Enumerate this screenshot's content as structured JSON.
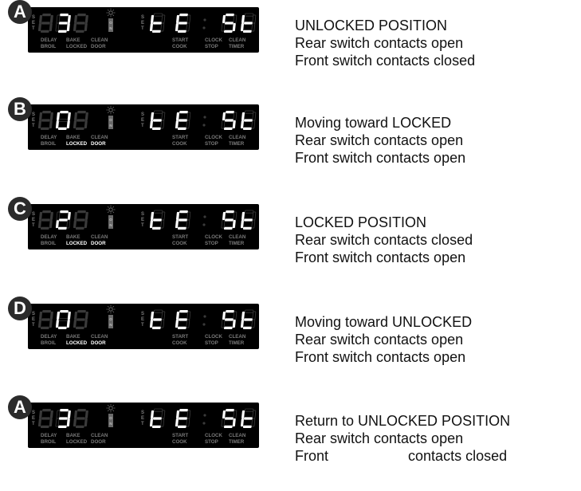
{
  "panel_labels": {
    "set": [
      "S",
      "E",
      "T"
    ],
    "left_row1": [
      "DELAY",
      "BAKE",
      "CLEAN"
    ],
    "left_row2": [
      "BROIL",
      "LOCKED",
      "DOOR"
    ],
    "right_row1": [
      "START",
      "CLOCK",
      "CLEAN"
    ],
    "right_row2": [
      "COOK",
      "STOP",
      "TIMER"
    ],
    "on_indicator": "O N"
  },
  "colors": {
    "panel": "#000000",
    "segment_on": "#ffffff",
    "segment_off": "#3a3a3a",
    "label_dim": "#7a7a7a",
    "label_bright": "#ffffff",
    "badge": "#2b2b2b"
  },
  "rows": [
    {
      "badge": "A",
      "left_digits": [
        "8",
        "3",
        "8"
      ],
      "left_lit": [
        false,
        true,
        false
      ],
      "right_text": [
        "t",
        "E",
        ":",
        "S",
        "t"
      ],
      "highlight_locked_door": false,
      "status": [
        "UNLOCKED POSITION",
        "Rear switch contacts open",
        "Front switch contacts closed"
      ]
    },
    {
      "badge": "B",
      "left_digits": [
        "8",
        "0",
        "8"
      ],
      "left_lit": [
        false,
        true,
        false
      ],
      "right_text": [
        "t",
        "E",
        ":",
        "S",
        "t"
      ],
      "highlight_locked_door": true,
      "status": [
        "Moving toward LOCKED",
        "Rear switch contacts open",
        "Front switch contacts open"
      ]
    },
    {
      "badge": "C",
      "left_digits": [
        "8",
        "2",
        "8"
      ],
      "left_lit": [
        false,
        true,
        false
      ],
      "right_text": [
        "t",
        "E",
        ":",
        "S",
        "t"
      ],
      "highlight_locked_door": true,
      "status": [
        "LOCKED POSITION",
        "Rear switch contacts closed",
        "Front switch contacts open"
      ]
    },
    {
      "badge": "D",
      "left_digits": [
        "8",
        "0",
        "8"
      ],
      "left_lit": [
        false,
        true,
        false
      ],
      "right_text": [
        "t",
        "E",
        ":",
        "S",
        "t"
      ],
      "highlight_locked_door": true,
      "status": [
        "Moving toward UNLOCKED",
        "Rear switch contacts open",
        "Front switch contacts open"
      ]
    },
    {
      "badge": "A",
      "left_digits": [
        "8",
        "3",
        "8"
      ],
      "left_lit": [
        false,
        true,
        false
      ],
      "right_text": [
        "t",
        "E",
        ":",
        "S",
        "t"
      ],
      "highlight_locked_door": false,
      "status": [
        "Return to UNLOCKED POSITION",
        "Rear switch contacts open",
        "Front                    contacts closed"
      ]
    }
  ]
}
